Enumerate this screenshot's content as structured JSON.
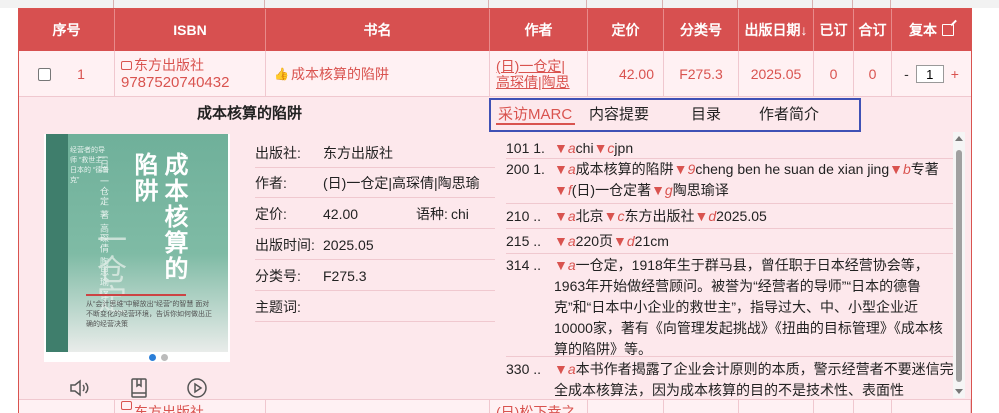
{
  "header": {
    "col_index": "序号",
    "col_isbn": "ISBN",
    "col_title": "书名",
    "col_author": "作者",
    "col_price": "定价",
    "col_class": "分类号",
    "col_date": "出版日期↓",
    "col_ordered": "已订",
    "col_total": "合订",
    "col_copies": "复本"
  },
  "row1": {
    "index": "1",
    "publisher": "东方出版社",
    "isbn": "9787520740432",
    "title": "成本核算的陷阱",
    "author_line1": "(日)一仓定|",
    "author_line2": "高琛倩|陶思",
    "price": "42.00",
    "class_no": "F275.3",
    "date": "2025.05",
    "ordered": "0",
    "total": "0",
    "minus": "-",
    "copies": "1",
    "plus": "+"
  },
  "detail": {
    "book_title": "成本核算的陷阱",
    "cover": {
      "title_right": "成本核算的",
      "title_left": "陷阱",
      "author": "[日] 一仓定 著 高琛倩 陶思瑜 译",
      "small_text": "经营者的导师 “救世主” 日本的 “德鲁克”",
      "big_text": "一仓定",
      "bottom_text": "从“会计思维”中解放出“经营”的智慧 面对不断变化的经营环境，告诉你如何做出正确的经营决策"
    },
    "info": {
      "publisher_label": "出版社:",
      "publisher": "东方出版社",
      "author_label": "作者:",
      "author": "(日)一仓定|高琛倩|陶思瑜",
      "price_label": "定价:",
      "price": "42.00",
      "lang_label": "语种:",
      "lang": "chi",
      "date_label": "出版时间:",
      "date": "2025.05",
      "class_label": "分类号:",
      "class_no": "F275.3",
      "subject_label": "主题词:"
    },
    "tabs": [
      "采访MARC",
      "内容提要",
      "目录",
      "作者简介"
    ],
    "marc": [
      {
        "tag": "101 1.",
        "parts": [
          "▼a",
          "chi",
          "▼c",
          "jpn"
        ]
      },
      {
        "tag": "200 1.",
        "parts": [
          "▼a",
          "成本核算的陷阱",
          "▼9",
          "cheng ben he suan de xian jing",
          "▼b",
          "专著",
          "▼f",
          "(日)一仓定著",
          "▼g",
          "陶思瑜译"
        ]
      },
      {
        "tag": "210 ..",
        "parts": [
          "▼a",
          "北京",
          "▼c",
          "东方出版社",
          "▼d",
          "2025.05"
        ]
      },
      {
        "tag": "215 ..",
        "parts": [
          "▼a",
          "220页",
          "▼d",
          "21cm"
        ]
      },
      {
        "tag": "314 ..",
        "parts": [
          "▼a",
          "一仓定，1918年生于群马县，曾任职于日本经营协会等，1963年开始做经营顾问。被誉为“经营者的导师”“日本的德鲁克”和“日本中小企业的救世主”，指导过大、中、小型企业近10000家，著有《向管理发起挑战》《扭曲的目标管理》《成本核算的陷阱》等。"
        ]
      },
      {
        "tag": "330 ..",
        "parts": [
          "▼a",
          "本书作者揭露了企业会计原则的本质，警示经营者不要迷信完全成本核算法，因为成本核算的目的不是技术性、表面性"
        ]
      }
    ]
  },
  "row2": {
    "publisher": "东方出版社",
    "author": "(日)松下幸之"
  }
}
